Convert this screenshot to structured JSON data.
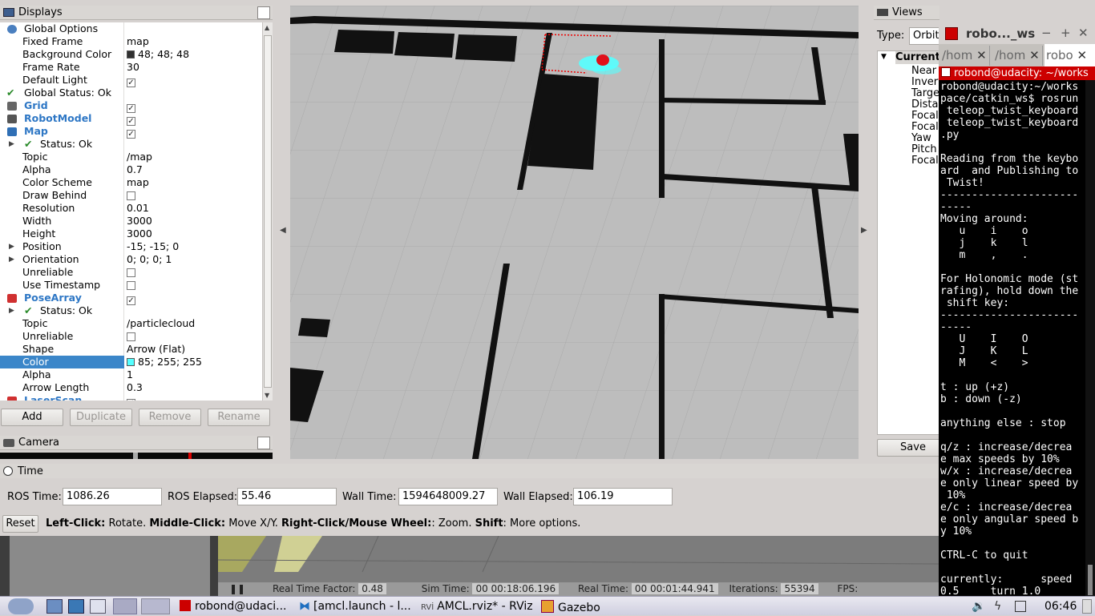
{
  "displays": {
    "title": "Displays",
    "rows": [
      {
        "name": "Global Options",
        "value": ""
      },
      {
        "name": "Fixed Frame",
        "value": "map"
      },
      {
        "name": "Background Color",
        "value": "48; 48; 48"
      },
      {
        "name": "Frame Rate",
        "value": "30"
      },
      {
        "name": "Default Light",
        "value": ""
      },
      {
        "name": "Global Status: Ok",
        "value": ""
      },
      {
        "name": "Grid",
        "value": ""
      },
      {
        "name": "RobotModel",
        "value": ""
      },
      {
        "name": "Map",
        "value": ""
      },
      {
        "name": "Status: Ok",
        "value": ""
      },
      {
        "name": "Topic",
        "value": "/map"
      },
      {
        "name": "Alpha",
        "value": "0.7"
      },
      {
        "name": "Color Scheme",
        "value": "map"
      },
      {
        "name": "Draw Behind",
        "value": ""
      },
      {
        "name": "Resolution",
        "value": "0.01"
      },
      {
        "name": "Width",
        "value": "3000"
      },
      {
        "name": "Height",
        "value": "3000"
      },
      {
        "name": "Position",
        "value": "-15; -15; 0"
      },
      {
        "name": "Orientation",
        "value": "0; 0; 0; 1"
      },
      {
        "name": "Unreliable",
        "value": ""
      },
      {
        "name": "Use Timestamp",
        "value": ""
      },
      {
        "name": "PoseArray",
        "value": ""
      },
      {
        "name": "Status: Ok",
        "value": ""
      },
      {
        "name": "Topic",
        "value": "/particlecloud"
      },
      {
        "name": "Unreliable",
        "value": ""
      },
      {
        "name": "Shape",
        "value": "Arrow (Flat)"
      },
      {
        "name": "Color",
        "value": "85; 255; 255"
      },
      {
        "name": "Alpha",
        "value": "1"
      },
      {
        "name": "Arrow Length",
        "value": "0.3"
      },
      {
        "name": "LaserScan",
        "value": ""
      }
    ],
    "buttons": {
      "add": "Add",
      "duplicate": "Duplicate",
      "remove": "Remove",
      "rename": "Rename"
    },
    "colors": {
      "background": "#303030",
      "particle": "#55ffff",
      "accent": "#3b86c9"
    }
  },
  "camera": {
    "title": "Camera"
  },
  "views": {
    "title": "Views",
    "type_label": "Type:",
    "type_value": "Orbit",
    "current": "Current",
    "items": [
      "Near",
      "Invert",
      "Target",
      "Distance",
      "Focal",
      "Focal",
      "Yaw",
      "Pitch",
      "Focal"
    ],
    "save": "Save"
  },
  "time": {
    "title": "Time",
    "ros_time_label": "ROS Time:",
    "ros_time": "1086.26",
    "ros_elapsed_label": "ROS Elapsed:",
    "ros_elapsed": "55.46",
    "wall_time_label": "Wall Time:",
    "wall_time": "1594648009.27",
    "wall_elapsed_label": "Wall Elapsed:",
    "wall_elapsed": "106.19"
  },
  "status": {
    "reset": "Reset",
    "b1": "Left-Click:",
    "t1": "Rotate.",
    "b2": "Middle-Click:",
    "t2": "Move X/Y.",
    "b3": "Right-Click/Mouse Wheel:",
    "t3": ": Zoom.",
    "b4": "Shift",
    "t4": ": More options."
  },
  "gazebo": {
    "rtf_label": "Real Time Factor:",
    "rtf": "0.48",
    "sim_label": "Sim Time:",
    "sim": "00 00:18:06.196",
    "real_label": "Real Time:",
    "real": "00 00:01:44.941",
    "iter_label": "Iterations:",
    "iter": "55394",
    "fps_label": "FPS:"
  },
  "terminal": {
    "window_title": "robo..._ws",
    "tabs": [
      "/hom",
      "/hom",
      "robo"
    ],
    "active_title": "robond@udacity: ~/works",
    "lines": [
      "robond@udacity:~/works",
      "pace/catkin_ws$ rosrun",
      " teleop_twist_keyboard",
      " teleop_twist_keyboard",
      ".py",
      "",
      "Reading from the keybo",
      "ard  and Publishing to",
      " Twist!",
      "----------------------",
      "-----",
      "Moving around:",
      "   u    i    o",
      "   j    k    l",
      "   m    ,    .",
      "",
      "For Holonomic mode (st",
      "rafing), hold down the",
      " shift key:",
      "----------------------",
      "-----",
      "   U    I    O",
      "   J    K    L",
      "   M    <    >",
      "",
      "t : up (+z)",
      "b : down (-z)",
      "",
      "anything else : stop",
      "",
      "q/z : increase/decrea",
      "e max speeds by 10%",
      "w/x : increase/decrea",
      "e only linear speed by",
      " 10%",
      "e/c : increase/decrea",
      "e only angular speed b",
      "y 10%",
      "",
      "CTRL-C to quit",
      "",
      "currently:      speed",
      "0.5     turn 1.0"
    ]
  },
  "taskbar": {
    "items": [
      "robond@udaci...",
      "[amcl.launch - l...",
      "AMCL.rviz* - RViz",
      "Gazebo"
    ],
    "clock": "06:46"
  }
}
